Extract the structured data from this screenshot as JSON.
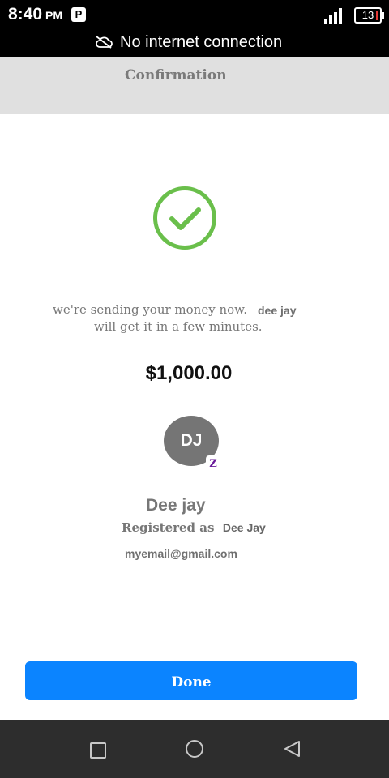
{
  "status_bar": {
    "time": "8:40",
    "ampm": "PM",
    "battery_level": "13",
    "network_message": "No internet connection"
  },
  "header": {
    "title": "Confirmation"
  },
  "confirmation": {
    "message_line1": "we're sending your money now.",
    "recipient_short": "dee jay",
    "message_line2": "will get it in a few minutes.",
    "amount": "$1,000.00"
  },
  "recipient": {
    "initials": "DJ",
    "badge": "Z",
    "name": "Dee jay",
    "registered_label": "Registered as",
    "registered_name": "Dee Jay",
    "email": "myemail@gmail.com"
  },
  "actions": {
    "done_label": "Done"
  },
  "colors": {
    "accent": "#0b84ff",
    "success": "#6abf4b",
    "avatar": "#757575",
    "badge_text": "#6a1b9a"
  },
  "icons": [
    "cloud-off-icon",
    "signal-icon",
    "battery-icon",
    "check-circle-icon",
    "square-nav-icon",
    "home-circle-icon",
    "back-triangle-icon"
  ]
}
